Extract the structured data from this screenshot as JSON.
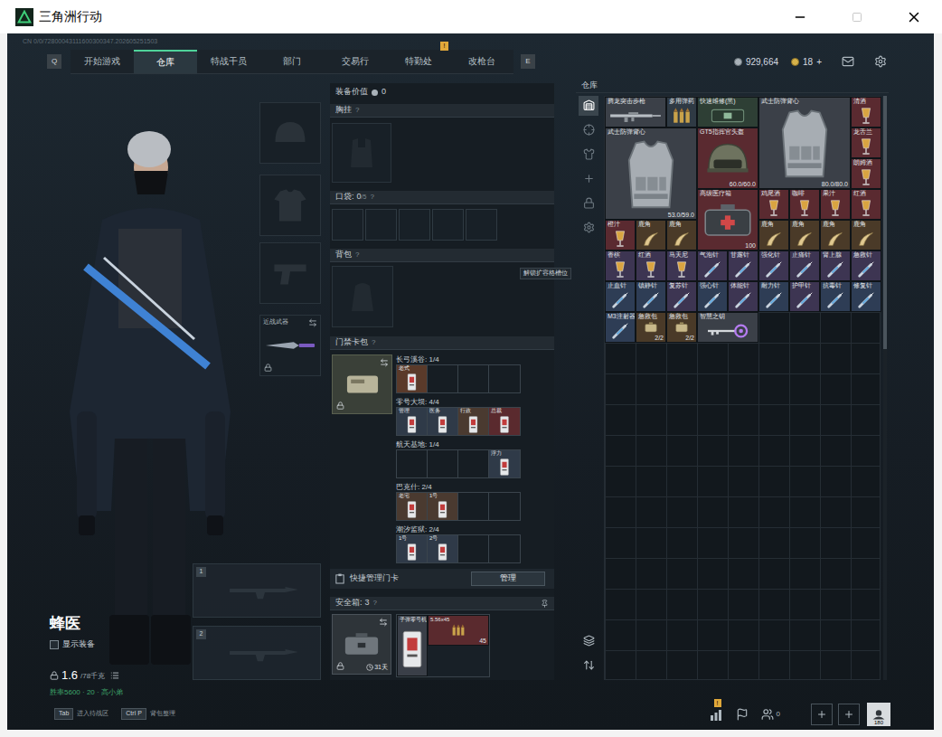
{
  "window": {
    "title": "三角洲行动"
  },
  "build_id": "CN 0/0/72800043111600300347.202605251503",
  "nav": {
    "prev_key": "Q",
    "next_key": "E",
    "tabs": [
      {
        "label": "开始游戏",
        "selected": false
      },
      {
        "label": "仓库",
        "selected": true
      },
      {
        "label": "特战干员",
        "selected": false
      },
      {
        "label": "部门",
        "selected": false
      },
      {
        "label": "交易行",
        "selected": false
      },
      {
        "label": "特勤处",
        "selected": false,
        "badge": "!"
      },
      {
        "label": "改枪台",
        "selected": false
      }
    ]
  },
  "currency": {
    "coins": "929,664",
    "bonds": "18",
    "add": "+"
  },
  "operator": {
    "name": "蜂医",
    "show_gear": {
      "label": "显示装备",
      "checked": false
    },
    "weight": "1.6",
    "capacity": "/78千克",
    "note": "胜率5600 · 20 · 高小弟"
  },
  "gear_slots": [
    {
      "kind": "helmet",
      "locked": false
    },
    {
      "kind": "armor",
      "locked": false
    },
    {
      "kind": "pistol",
      "locked": false
    },
    {
      "kind": "melee",
      "label": "近战武器",
      "locked": true
    }
  ],
  "weapon_slots": [
    {
      "number": "1"
    },
    {
      "number": "2"
    }
  ],
  "loadout": {
    "value_label": "装备价值",
    "value": "0",
    "chest_rig": {
      "label": "胸挂",
      "help": "?"
    },
    "pockets": {
      "label": "口袋:",
      "count": "0",
      "capacity": "/5",
      "help": "?",
      "slots": 5
    },
    "backpack": {
      "label": "背包",
      "help": "?",
      "tooltip": "解锁扩容格槽位"
    },
    "keycard_case": {
      "label": "门禁卡包",
      "help": "?",
      "locked": true,
      "quick_manage": "快捷管理门卡",
      "manage_button": "管理",
      "maps": [
        {
          "name": "长弓溪谷:",
          "count": "1/4",
          "slots": [
            {
              "filled": true,
              "name": "老式",
              "color": "#5a3a2a"
            },
            {
              "filled": false
            },
            {
              "filled": false
            },
            {
              "filled": false
            }
          ]
        },
        {
          "name": "零号大坝:",
          "count": "4/4",
          "slots": [
            {
              "filled": true,
              "name": "管理",
              "color": "#2f3a48"
            },
            {
              "filled": true,
              "name": "医务",
              "color": "#2f3a48"
            },
            {
              "filled": true,
              "name": "行政",
              "color": "#4a3a30"
            },
            {
              "filled": true,
              "name": "总裁",
              "color": "#5a2a2e"
            }
          ]
        },
        {
          "name": "航天基地:",
          "count": "1/4",
          "slots": [
            {
              "filled": false
            },
            {
              "filled": false
            },
            {
              "filled": false
            },
            {
              "filled": true,
              "name": "浮力",
              "color": "#2f3a48"
            }
          ]
        },
        {
          "name": "巴克什:",
          "count": "2/4",
          "slots": [
            {
              "filled": true,
              "name": "老宅",
              "color": "#4a3a30"
            },
            {
              "filled": true,
              "name": "1号",
              "color": "#4a3a30"
            },
            {
              "filled": false
            },
            {
              "filled": false
            }
          ]
        },
        {
          "name": "潮汐监狱:",
          "count": "2/4",
          "slots": [
            {
              "filled": true,
              "name": "1号",
              "color": "#2f3a48"
            },
            {
              "filled": true,
              "name": "2号",
              "color": "#2f3a48"
            },
            {
              "filled": false
            },
            {
              "filled": false
            }
          ]
        }
      ]
    },
    "safebox": {
      "label": "安全箱:",
      "count": "3",
      "help": "?",
      "days": "31天",
      "locked": true,
      "items": [
        {
          "name": "子弹零号机",
          "kind": "card",
          "color": "#3a3f48"
        },
        {
          "name": "5.56x45",
          "kind": "ammo",
          "count": "45",
          "color": "#5a2a2e"
        }
      ]
    }
  },
  "warehouse": {
    "title": "仓库",
    "sidebar": {
      "top": [
        {
          "kind": "all",
          "selected": true
        },
        {
          "kind": "weapon",
          "selected": false
        },
        {
          "kind": "gear",
          "selected": false
        },
        {
          "kind": "add",
          "selected": false
        },
        {
          "kind": "locked",
          "selected": false
        },
        {
          "kind": "settings",
          "selected": false
        }
      ],
      "bottom": [
        {
          "kind": "layers",
          "selected": false
        },
        {
          "kind": "sort",
          "selected": false
        }
      ]
    },
    "items": [
      {
        "name": "腾龙突击步枪",
        "kind": "rifle",
        "color": "#3b4048"
      },
      {
        "name": "多用弹药",
        "kind": "ammo",
        "color": "#2f3a44"
      },
      {
        "name": "快速维修(黑)",
        "kind": "repair",
        "color": "#2e3f35"
      },
      {
        "name": "武士防弹背心",
        "kind": "armor",
        "color": "#3b4048",
        "durability": "80.0/80.0"
      },
      {
        "name": "清酒",
        "kind": "drink",
        "color": "#5a2a30"
      },
      {
        "name": "武士防弹背心",
        "kind": "armor",
        "color": "#3b4048",
        "durability": "53.0/59.0"
      },
      {
        "name": "GT5指挥官头盔",
        "kind": "helmet",
        "color": "#5a2a30",
        "durability": "60.0/60.0"
      },
      {
        "name": "龙舌兰",
        "kind": "drink",
        "color": "#5a2a30"
      },
      {
        "name": "朗姆酒",
        "kind": "drink",
        "color": "#5a2a30"
      },
      {
        "name": "高级医疗箱",
        "kind": "case",
        "color": "#5a2a30",
        "count": "100"
      },
      {
        "name": "鸡尾酒",
        "kind": "drink",
        "color": "#5a2a30"
      },
      {
        "name": "咖啡",
        "kind": "drink",
        "color": "#5a2a30"
      },
      {
        "name": "果汁",
        "kind": "drink",
        "color": "#5a2a30"
      },
      {
        "name": "红酒",
        "kind": "drink",
        "color": "#5a2a30"
      },
      {
        "name": "橙汁",
        "kind": "drink",
        "color": "#5a2a30"
      },
      {
        "name": "鹿角",
        "kind": "horn",
        "color": "#4a3a28"
      },
      {
        "name": "鹿角",
        "kind": "horn",
        "color": "#4a3a28"
      },
      {
        "name": "鹿角",
        "kind": "horn",
        "color": "#4a3a28"
      },
      {
        "name": "鹿角",
        "kind": "horn",
        "color": "#4a3a28"
      },
      {
        "name": "鹿角",
        "kind": "horn",
        "color": "#4a3a28"
      },
      {
        "name": "鹿角",
        "kind": "horn",
        "color": "#4a3a28"
      },
      {
        "name": "香槟",
        "kind": "drink",
        "color": "#3d3552"
      },
      {
        "name": "红酒",
        "kind": "drink",
        "color": "#3d3552"
      },
      {
        "name": "马天尼",
        "kind": "drink",
        "color": "#3d3552"
      },
      {
        "name": "气泡针",
        "kind": "syringe",
        "color": "#3d3552"
      },
      {
        "name": "甘露针",
        "kind": "syringe",
        "color": "#3d3552"
      },
      {
        "name": "强化针",
        "kind": "syringe",
        "color": "#3d3552"
      },
      {
        "name": "止痛针",
        "kind": "syringe",
        "color": "#3d3552"
      },
      {
        "name": "肾上腺",
        "kind": "syringe",
        "color": "#3d3552"
      },
      {
        "name": "急救针",
        "kind": "syringe",
        "color": "#3d3552"
      },
      {
        "name": "止血针",
        "kind": "syringe",
        "color": "#2e3d55"
      },
      {
        "name": "镇静针",
        "kind": "syringe",
        "color": "#2e3d55"
      },
      {
        "name": "复苏针",
        "kind": "syringe",
        "color": "#3d3552"
      },
      {
        "name": "强心针",
        "kind": "syringe",
        "color": "#2e3d55"
      },
      {
        "name": "体能针",
        "kind": "syringe",
        "color": "#3d3552"
      },
      {
        "name": "耐力针",
        "kind": "syringe",
        "color": "#2e3d55"
      },
      {
        "name": "护甲针",
        "kind": "syringe",
        "color": "#3d3552"
      },
      {
        "name": "抗毒针",
        "kind": "syringe",
        "color": "#2e3d55"
      },
      {
        "name": "修复针",
        "kind": "syringe",
        "color": "#2e3d55"
      },
      {
        "name": "M3注射器",
        "kind": "syringe",
        "color": "#2e3d55"
      },
      {
        "name": "急救包",
        "kind": "bag",
        "color": "#4a3a28",
        "count": "2/2"
      },
      {
        "name": "急救包",
        "kind": "bag",
        "color": "#4a3a28",
        "count": "2/2"
      },
      {
        "name": "智慧之钥",
        "kind": "key",
        "color": "#3b4048"
      }
    ]
  },
  "footer": {
    "hints": [
      {
        "key": "Tab",
        "label": "进入待战区"
      },
      {
        "key": "Ctrl P",
        "label": "背包整理"
      }
    ],
    "stats_badge": "!",
    "friends": "0",
    "avatar_level": "180"
  }
}
